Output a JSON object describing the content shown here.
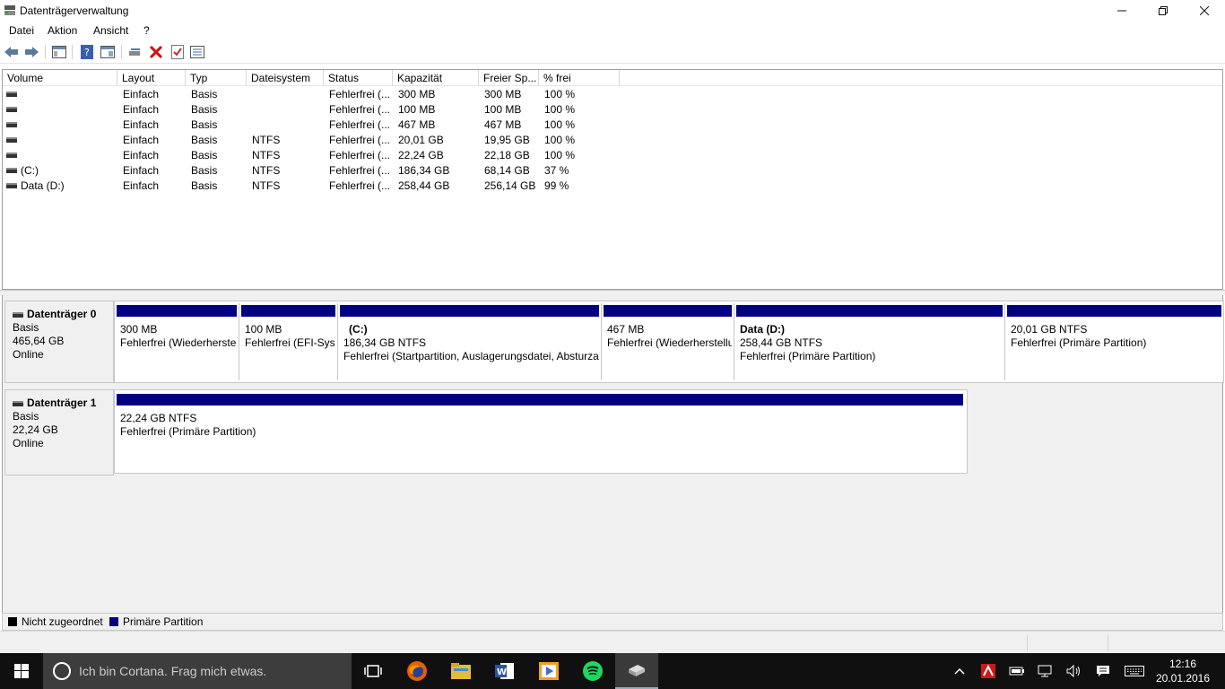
{
  "window": {
    "title": "Datenträgerverwaltung",
    "minimize_icon": "minimize-icon",
    "maximize_icon": "restore-icon",
    "close_icon": "close-icon"
  },
  "menu": [
    "Datei",
    "Aktion",
    "Ansicht",
    "?"
  ],
  "toolbar": [
    "back-icon",
    "forward-icon",
    "console-tree-icon",
    "help-icon",
    "properties-icon",
    "connect-icon",
    "delete-icon",
    "check-icon",
    "list-icon"
  ],
  "volume_table": {
    "columns": [
      "Volume",
      "Layout",
      "Typ",
      "Dateisystem",
      "Status",
      "Kapazität",
      "Freier Sp...",
      "% frei"
    ],
    "rows": [
      {
        "volume": "",
        "layout": "Einfach",
        "typ": "Basis",
        "fs": "",
        "status": "Fehlerfrei (...",
        "capacity": "300 MB",
        "free": "300 MB",
        "pct": "100 %"
      },
      {
        "volume": "",
        "layout": "Einfach",
        "typ": "Basis",
        "fs": "",
        "status": "Fehlerfrei (...",
        "capacity": "100 MB",
        "free": "100 MB",
        "pct": "100 %"
      },
      {
        "volume": "",
        "layout": "Einfach",
        "typ": "Basis",
        "fs": "",
        "status": "Fehlerfrei (...",
        "capacity": "467 MB",
        "free": "467 MB",
        "pct": "100 %"
      },
      {
        "volume": "",
        "layout": "Einfach",
        "typ": "Basis",
        "fs": "NTFS",
        "status": "Fehlerfrei (...",
        "capacity": "20,01 GB",
        "free": "19,95 GB",
        "pct": "100 %"
      },
      {
        "volume": "",
        "layout": "Einfach",
        "typ": "Basis",
        "fs": "NTFS",
        "status": "Fehlerfrei (...",
        "capacity": "22,24 GB",
        "free": "22,18 GB",
        "pct": "100 %"
      },
      {
        "volume": "(C:)",
        "layout": "Einfach",
        "typ": "Basis",
        "fs": "NTFS",
        "status": "Fehlerfrei (...",
        "capacity": "186,34 GB",
        "free": "68,14 GB",
        "pct": "37 %"
      },
      {
        "volume": "Data (D:)",
        "layout": "Einfach",
        "typ": "Basis",
        "fs": "NTFS",
        "status": "Fehlerfrei (...",
        "capacity": "258,44 GB",
        "free": "256,14 GB",
        "pct": "99 %"
      }
    ]
  },
  "disks": [
    {
      "name": "Datenträger 0",
      "type": "Basis",
      "size": "465,64 GB",
      "state": "Online",
      "partitions": [
        {
          "name": "",
          "size": "300 MB",
          "status": "Fehlerfrei (Wiederherstellungspartition)"
        },
        {
          "name": "",
          "size": "100 MB",
          "status": "Fehlerfrei (EFI-Systempartition)"
        },
        {
          "name": "(C:)",
          "size": "186,34 GB NTFS",
          "status": "Fehlerfrei (Startpartition, Auslagerungsdatei, Absturzabbild, Primäre Partition)"
        },
        {
          "name": "",
          "size": "467 MB",
          "status": "Fehlerfrei (Wiederherstellungspartition)"
        },
        {
          "name": "Data  (D:)",
          "size": "258,44 GB NTFS",
          "status": "Fehlerfrei (Primäre Partition)"
        },
        {
          "name": "",
          "size": "20,01 GB NTFS",
          "status": "Fehlerfrei (Primäre Partition)"
        }
      ]
    },
    {
      "name": "Datenträger 1",
      "type": "Basis",
      "size": "22,24 GB",
      "state": "Online",
      "partitions": [
        {
          "name": "",
          "size": "22,24 GB NTFS",
          "status": "Fehlerfrei (Primäre Partition)"
        }
      ]
    }
  ],
  "legend": [
    {
      "label": "Nicht zugeordnet",
      "color": "#000000"
    },
    {
      "label": "Primäre Partition",
      "color": "#000080"
    }
  ],
  "taskbar": {
    "search_placeholder": "Ich bin Cortana. Frag mich etwas.",
    "apps": [
      "task-view-icon",
      "firefox-icon",
      "file-explorer-icon",
      "word-icon",
      "media-player-icon",
      "spotify-icon",
      "disk-management-icon"
    ],
    "tray": [
      "chevron-up-icon",
      "antivirus-icon",
      "battery-icon",
      "network-icon",
      "volume-icon",
      "action-center-icon",
      "keyboard-icon"
    ],
    "time": "12:16",
    "date": "20.01.2016"
  }
}
